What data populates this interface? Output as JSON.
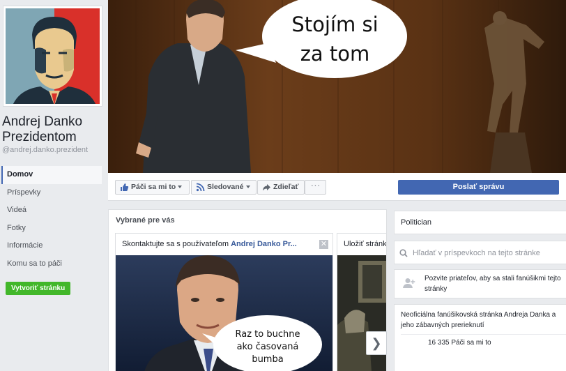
{
  "page": {
    "name_line1": "Andrej Danko",
    "name_line2": "Prezidentom",
    "handle": "@andrej.danko.prezident"
  },
  "nav": {
    "items": [
      {
        "label": "Domov",
        "active": true
      },
      {
        "label": "Príspevky"
      },
      {
        "label": "Videá"
      },
      {
        "label": "Fotky"
      },
      {
        "label": "Informácie"
      },
      {
        "label": "Komu sa to páči"
      }
    ],
    "create_page": "Vytvoriť stránku"
  },
  "cover": {
    "bubble_line1": "Stojím si",
    "bubble_line2": "za tom"
  },
  "actions": {
    "like": "Páči sa mi to",
    "follow": "Sledované",
    "share": "Zdieľať",
    "more": "···",
    "send_message": "Poslať správu"
  },
  "featured": {
    "title": "Vybrané pre vás",
    "card1_prefix": "Skontaktujte sa s používateľom ",
    "card1_name": "Andrej Danko Pr...",
    "card1_bubble_line1": "Raz to buchne",
    "card1_bubble_line2": "ako časovaná",
    "card1_bubble_line3": "bumba",
    "card2_head": "Uložiť stránku"
  },
  "sidebar": {
    "category": "Politician",
    "search_placeholder": "Hľadať v príspevkoch na tejto stránke",
    "invite": "Pozvite priateľov, aby sa stali fanúšikmi tejto stránky",
    "about": "Neoficiálna fanúšikovská stránka Andreja Danka a jeho zábavných prerieknutí",
    "likes": "16 335 Páči sa mi to"
  },
  "colors": {
    "brand_blue": "#4267b2",
    "create_green": "#42b72a",
    "background": "#e9ebee"
  }
}
